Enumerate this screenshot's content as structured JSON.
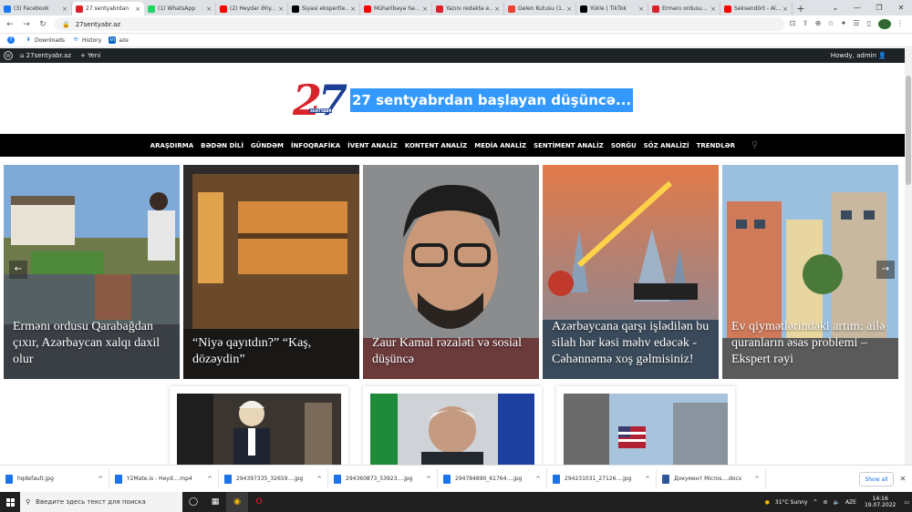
{
  "browser": {
    "tabs": [
      {
        "title": "(3) Facebook",
        "color": "#1877f2"
      },
      {
        "title": "27 sentyabrdan",
        "color": "#d8232a",
        "active": true
      },
      {
        "title": "(1) WhatsApp",
        "color": "#25d366"
      },
      {
        "title": "(2) Heydar Əliy...",
        "color": "#ff0000"
      },
      {
        "title": "Siyasi ekspertle...",
        "color": "#000000"
      },
      {
        "title": "Müharibəyə hə...",
        "color": "#ff0000"
      },
      {
        "title": "Yazını redaktə e...",
        "color": "#d8232a"
      },
      {
        "title": "Gelen Kutusu (1...",
        "color": "#ea4335"
      },
      {
        "title": "Yükle | TikTok",
        "color": "#000000"
      },
      {
        "title": "Ermənı ordusu...",
        "color": "#d8232a"
      },
      {
        "title": "Seksendört - Al...",
        "color": "#ff0000"
      }
    ],
    "url": "27sentyabr.az",
    "bookmarks": [
      {
        "label": "Downloads",
        "icon": "download-icon"
      },
      {
        "label": "History",
        "icon": "history-icon"
      },
      {
        "label": "aze",
        "icon": "in-icon"
      }
    ],
    "profile_initial": "N"
  },
  "wp": {
    "site": "27sentyabr.az",
    "new": "Yeni",
    "howdy": "Howdy, admin"
  },
  "header": {
    "logo_digits": "27",
    "logo_sub": "SENTYABR",
    "tagline": "27 sentyabrdan başlayan düşüncə..."
  },
  "nav": [
    "ARAŞDIRMA",
    "BƏDƏN DİLİ",
    "GÜNDƏM",
    "İNFOQRAFİKA",
    "İVENT ANALİZ",
    "KONTENT ANALİZ",
    "MEDİA ANALİZ",
    "SENTİMENT ANALİZ",
    "SORĞU",
    "SÖZ ANALİZİ",
    "TRENDLƏR"
  ],
  "slides": [
    {
      "caption": "Ermənı ordusu Qarabağdan çıxır, Azərbaycan xalqı daxil olur"
    },
    {
      "caption": "“Niyə qayıtdın?” “Kaş, dözəydin”"
    },
    {
      "caption": "Zaur Kamal rəzaləti və sosial düşüncə"
    },
    {
      "caption": "Azərbaycana qarşı işlədilən bu silah hər kəsi məhv edəcək - Cəhənnəmə xoş gəlmisiniz!"
    },
    {
      "caption": "Ev qiymətlərindəki artım: ailə quranların əsas problemi – Ekspert rəyi"
    }
  ],
  "downloads": [
    {
      "name": "hqdefault.jpg",
      "color": "#1a73e8"
    },
    {
      "name": "Y2Mate.is - Heyd....mp4",
      "color": "#1a73e8"
    },
    {
      "name": "294397335_32659....jpg",
      "color": "#1a73e8"
    },
    {
      "name": "294360873_53923....jpg",
      "color": "#1a73e8"
    },
    {
      "name": "294784890_61764....jpg",
      "color": "#1a73e8"
    },
    {
      "name": "294231031_27126....jpg",
      "color": "#1a73e8"
    },
    {
      "name": "Документ Micros....docx",
      "color": "#2b579a"
    }
  ],
  "show_all": "Show all",
  "taskbar": {
    "search": "Введите здесь текст для поиска",
    "weather": "31°C  Sunny",
    "lang": "AZE",
    "time": "14:16",
    "date": "19.07.2022"
  }
}
